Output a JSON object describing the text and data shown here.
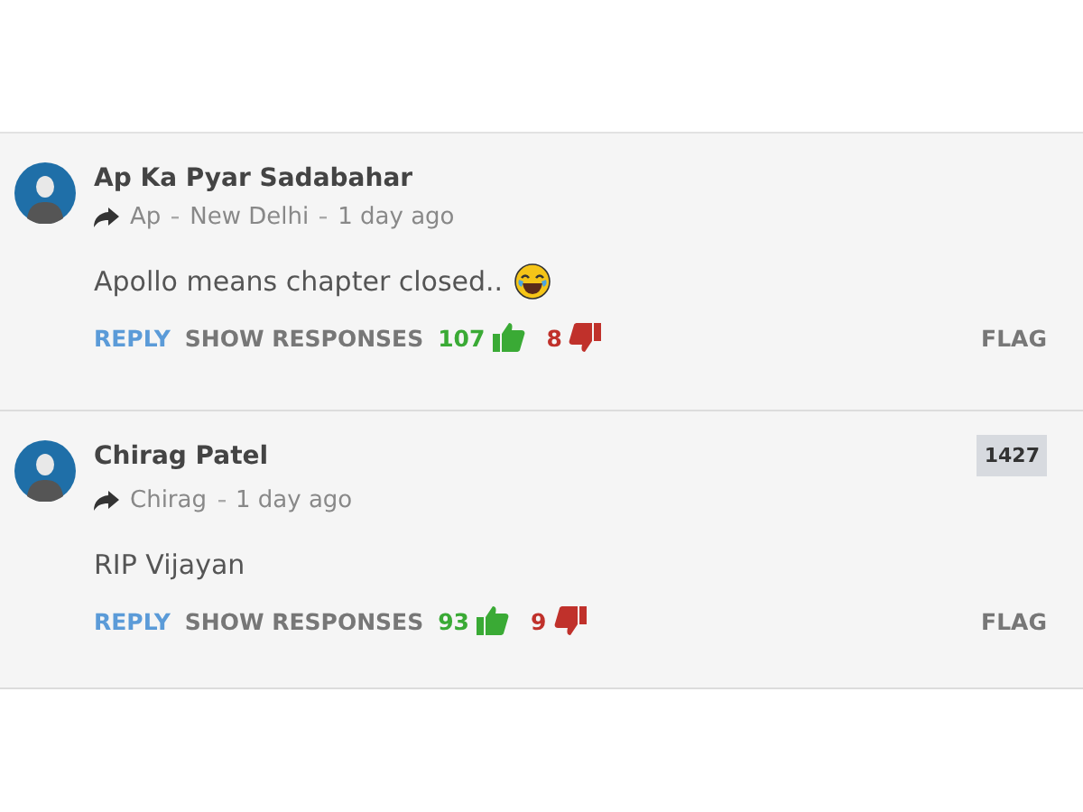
{
  "comments": [
    {
      "author": "Ap Ka Pyar Sadabahar",
      "meta": [
        "Ap",
        "New Delhi",
        "1 day ago"
      ],
      "text": "Apollo means chapter closed..",
      "has_emoji": true,
      "reply": "REPLY",
      "show_responses": "SHOW RESPONSES",
      "upvotes": "107",
      "downvotes": "8",
      "flag": "FLAG"
    },
    {
      "author": "Chirag Patel",
      "badge": "1427",
      "meta": [
        "Chirag",
        "1 day ago"
      ],
      "text": "RIP Vijayan",
      "has_emoji": false,
      "reply": "REPLY",
      "show_responses": "SHOW RESPONSES",
      "upvotes": "93",
      "downvotes": "9",
      "flag": "FLAG"
    }
  ]
}
